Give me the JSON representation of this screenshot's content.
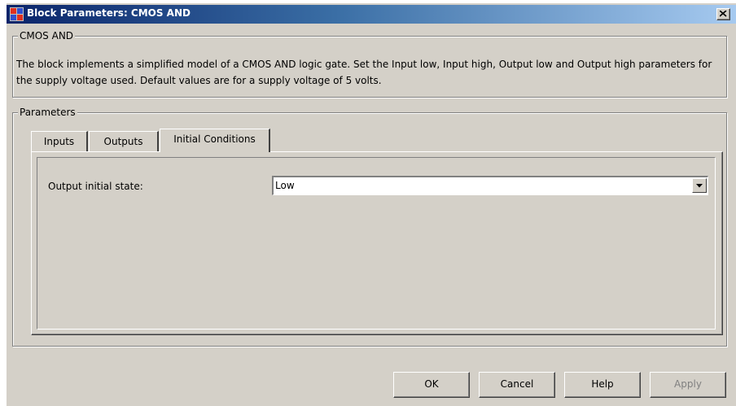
{
  "window": {
    "title": "Block Parameters: CMOS AND"
  },
  "block_group": {
    "legend": "CMOS AND",
    "description": "The block implements a simplified model of a CMOS AND logic gate. Set the Input low, Input high, Output low and Output high parameters for the supply voltage used. Default values are for a supply voltage of 5 volts."
  },
  "parameters_group": {
    "legend": "Parameters",
    "tabs": [
      {
        "label": "Inputs",
        "active": false
      },
      {
        "label": "Outputs",
        "active": false
      },
      {
        "label": "Initial Conditions",
        "active": true
      }
    ]
  },
  "initial_conditions": {
    "output_initial_state_label": "Output initial state:",
    "output_initial_state_value": "Low"
  },
  "buttons": {
    "ok": "OK",
    "cancel": "Cancel",
    "help": "Help",
    "apply": "Apply",
    "apply_enabled": false
  },
  "colors": {
    "face": "#d4d0c8",
    "titlebar_start": "#0a246a",
    "titlebar_end": "#a6caf0"
  }
}
